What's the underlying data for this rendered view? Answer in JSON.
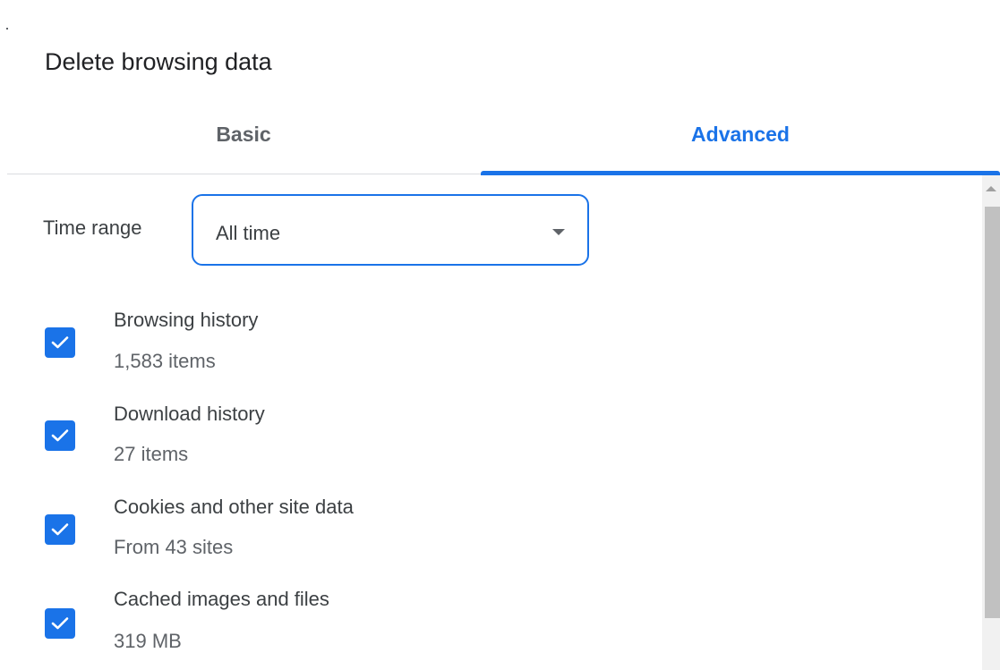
{
  "dialog": {
    "title": "Delete browsing data"
  },
  "tabs": [
    {
      "label": "Basic",
      "selected": false
    },
    {
      "label": "Advanced",
      "selected": true
    }
  ],
  "time_range": {
    "label": "Time range",
    "value": "All time"
  },
  "options": [
    {
      "label": "Browsing history",
      "detail": "1,583 items",
      "checked": true
    },
    {
      "label": "Download history",
      "detail": "27 items",
      "checked": true
    },
    {
      "label": "Cookies and other site data",
      "detail": "From 43 sites",
      "checked": true
    },
    {
      "label": "Cached images and files",
      "detail": "319 MB",
      "checked": true
    }
  ],
  "colors": {
    "accent": "#1a73e8",
    "text_primary": "#202124",
    "text_secondary": "#5f6368",
    "divider": "#dadce0"
  },
  "icons": {
    "checkbox": "check-icon",
    "select": "dropdown-arrow-icon",
    "scroll": "scroll-up-arrow-icon"
  }
}
